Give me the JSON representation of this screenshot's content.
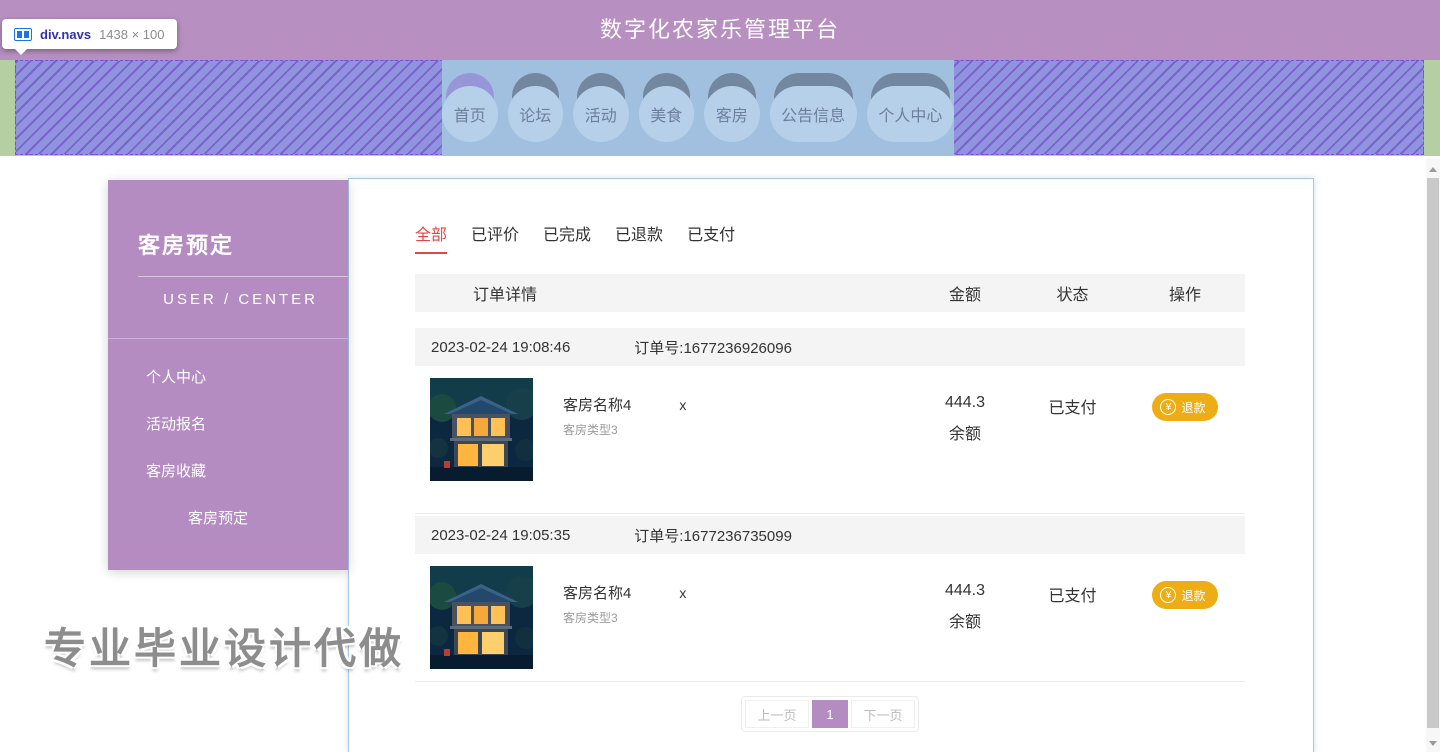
{
  "devtools": {
    "selector": "div.navs",
    "dimensions": "1438 × 100"
  },
  "header": {
    "title": "数字化农家乐管理平台"
  },
  "nav": {
    "items": [
      {
        "label": "首页",
        "active": true
      },
      {
        "label": "论坛",
        "active": false
      },
      {
        "label": "活动",
        "active": false
      },
      {
        "label": "美食",
        "active": false
      },
      {
        "label": "客房",
        "active": false
      },
      {
        "label": "公告信息",
        "active": false
      },
      {
        "label": "个人中心",
        "active": false
      }
    ]
  },
  "sidebar": {
    "title": "客房预定",
    "subtitle": "USER / CENTER",
    "menu": [
      {
        "label": "个人中心",
        "active": false
      },
      {
        "label": "活动报名",
        "active": false
      },
      {
        "label": "客房收藏",
        "active": false
      },
      {
        "label": "客房预定",
        "active": true
      }
    ]
  },
  "orders": {
    "tabs": [
      {
        "label": "全部",
        "active": true
      },
      {
        "label": "已评价",
        "active": false
      },
      {
        "label": "已完成",
        "active": false
      },
      {
        "label": "已退款",
        "active": false
      },
      {
        "label": "已支付",
        "active": false
      }
    ],
    "columns": [
      "订单详情",
      "金额",
      "状态",
      "操作"
    ],
    "yuan_symbol": "¥",
    "groups": [
      {
        "datetime": "2023-02-24 19:08:46",
        "order_no": "订单号:1677236926096",
        "item": {
          "name": "客房名称4",
          "multiplier": "x",
          "type": "客房类型3",
          "amount": "444.3",
          "balance_label": "余额",
          "status": "已支付",
          "action_label": "退款",
          "image_name": "room-night-house-photo"
        }
      },
      {
        "datetime": "2023-02-24 19:05:35",
        "order_no": "订单号:1677236735099",
        "item": {
          "name": "客房名称4",
          "multiplier": "x",
          "type": "客房类型3",
          "amount": "444.3",
          "balance_label": "余额",
          "status": "已支付",
          "action_label": "退款",
          "image_name": "room-night-house-photo"
        }
      }
    ],
    "pagination": {
      "prev_label": "上一页",
      "current_page": "1",
      "next_label": "下一页"
    }
  },
  "watermark": {
    "text": "专业毕业设计代做"
  },
  "colors": {
    "header_bg": "#b78fc1",
    "sidebar_bg": "#b48cc2",
    "accent_purple": "#b48cc2",
    "tab_active_red": "#e54545",
    "refund_button": "#efad15",
    "nav_highlight_blue": "#a1c0df",
    "devtools_hatch_purple": "#9094de",
    "page_margin_green": "#b5cfa2",
    "table_header_bg": "#f4f4f5"
  }
}
